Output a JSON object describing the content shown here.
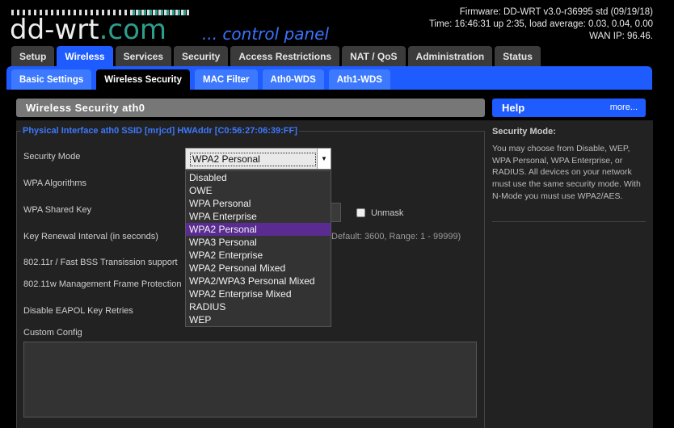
{
  "header": {
    "logo_main": "dd-wrt",
    "logo_suffix": ".com",
    "subtitle": "... control panel",
    "firmware": "Firmware: DD-WRT v3.0-r36995 std (09/19/18)",
    "time": "Time: 16:46:31 up 2:35, load average: 0.03, 0.04, 0.00",
    "wan_ip": "WAN IP: 96.46."
  },
  "tabs": [
    {
      "label": "Setup"
    },
    {
      "label": "Wireless"
    },
    {
      "label": "Services"
    },
    {
      "label": "Security"
    },
    {
      "label": "Access Restrictions"
    },
    {
      "label": "NAT / QoS"
    },
    {
      "label": "Administration"
    },
    {
      "label": "Status"
    }
  ],
  "subtabs": [
    {
      "label": "Basic Settings"
    },
    {
      "label": "Wireless Security"
    },
    {
      "label": "MAC Filter"
    },
    {
      "label": "Ath0-WDS"
    },
    {
      "label": "Ath1-WDS"
    }
  ],
  "main": {
    "title": "Wireless Security ath0",
    "legend": "Physical Interface ath0 SSID [mrjcd] HWAddr [C0:56:27:06:39:FF]",
    "labels": {
      "security_mode": "Security Mode",
      "wpa_algorithms": "WPA Algorithms",
      "wpa_shared_key": "WPA Shared Key",
      "key_renewal": "Key Renewal Interval (in seconds)",
      "fast_bss": "802.11r / Fast BSS Transission support",
      "mgmt_frame": "802.11w Management Frame Protection",
      "eapol": "Disable EAPOL Key Retries",
      "custom_config": "Custom Config"
    },
    "security_mode_value": "WPA2 Personal",
    "unmask_label": "Unmask",
    "key_renewal_note": "Default: 3600, Range: 1 - 99999)",
    "dropdown_options": [
      "Disabled",
      "OWE",
      "WPA Personal",
      "WPA Enterprise",
      "WPA2 Personal",
      "WPA3 Personal",
      "WPA2 Enterprise",
      "WPA2 Personal Mixed",
      "WPA2/WPA3 Personal Mixed",
      "WPA2 Enterprise Mixed",
      "RADIUS",
      "WEP"
    ],
    "selected_option": "WPA2 Personal"
  },
  "help": {
    "title": "Help",
    "more": "more...",
    "heading": "Security Mode:",
    "text": "You may choose from Disable, WEP, WPA Personal, WPA Enterprise, or RADIUS. All devices on your network must use the same security mode. With N-Mode you must use WPA2/AES."
  },
  "colors": {
    "accent": "#1f5cff",
    "selected_option": "#5a2c91",
    "logo_teal": "#2f9d8c"
  }
}
